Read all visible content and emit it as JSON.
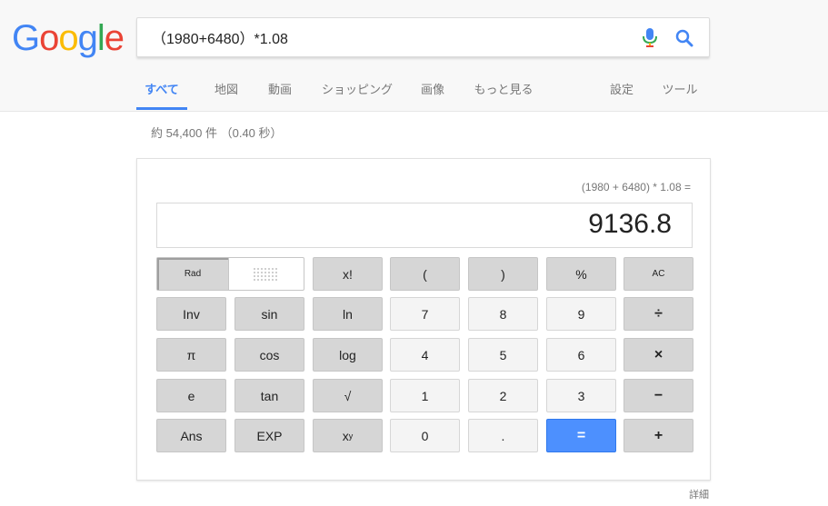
{
  "logo": {
    "letters": [
      "G",
      "o",
      "o",
      "g",
      "l",
      "e"
    ],
    "colors": [
      "#4285F4",
      "#EA4335",
      "#FBBC05",
      "#4285F4",
      "#34A853",
      "#EA4335"
    ]
  },
  "search": {
    "query": "（1980+6480）*1.08",
    "icons": [
      "mic-icon",
      "search-icon"
    ]
  },
  "tabs": [
    {
      "label": "すべて",
      "active": true
    },
    {
      "label": "地図"
    },
    {
      "label": "動画"
    },
    {
      "label": "ショッピング"
    },
    {
      "label": "画像"
    },
    {
      "label": "もっと見る"
    },
    {
      "label": "設定"
    },
    {
      "label": "ツール"
    }
  ],
  "stats": "約 54,400 件 （0.40 秒）",
  "calculator": {
    "history": "(1980 + 6480) * 1.08 =",
    "result": "9136.8",
    "rad_label": "Rad",
    "deg_icon": "deg-dots-icon",
    "keys": {
      "fact": "x!",
      "lparen": "(",
      "rparen": ")",
      "percent": "%",
      "ac": "AC",
      "inv": "Inv",
      "sin": "sin",
      "ln": "ln",
      "k7": "7",
      "k8": "8",
      "k9": "9",
      "div": "÷",
      "pi": "π",
      "cos": "cos",
      "log": "log",
      "k4": "4",
      "k5": "5",
      "k6": "6",
      "mul": "×",
      "e": "e",
      "tan": "tan",
      "sqrt": "√",
      "k1": "1",
      "k2": "2",
      "k3": "3",
      "minus": "−",
      "ans": "Ans",
      "exp": "EXP",
      "pow_base": "x",
      "pow_exp": "y",
      "k0": "0",
      "dot": ".",
      "equals": "=",
      "plus": "+"
    }
  },
  "details_link": "詳細",
  "colors": {
    "accent": "#4285f4",
    "equals_button": "#4d90fe",
    "dark_key": "#d6d6d6",
    "light_key": "#f4f4f4"
  }
}
